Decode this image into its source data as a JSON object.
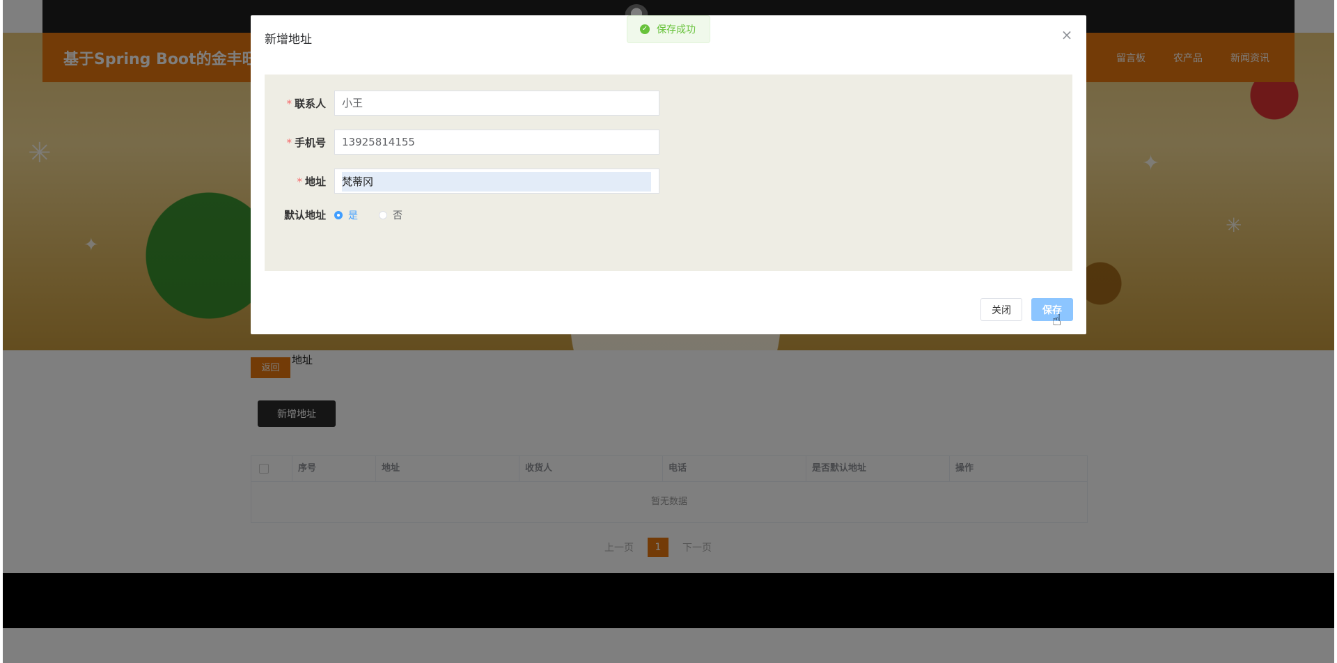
{
  "site": {
    "title": "基于Spring Boot的金丰旺",
    "nav": [
      "留言板",
      "农产品",
      "新闻资讯"
    ]
  },
  "page": {
    "back_label": "返回",
    "crumb": "地址",
    "add_label": "新增地址",
    "table": {
      "columns": [
        "序号",
        "地址",
        "收货人",
        "电话",
        "是否默认地址",
        "操作"
      ],
      "empty_text": "暂无数据"
    },
    "pager": {
      "prev": "上一页",
      "current": "1",
      "next": "下一页"
    }
  },
  "dialog": {
    "title": "新增地址",
    "fields": {
      "contact_label": "联系人",
      "contact_value": "小王",
      "phone_label": "手机号",
      "phone_value": "13925814155",
      "address_label": "地址",
      "address_value": "梵蒂冈",
      "default_label": "默认地址",
      "default_yes": "是",
      "default_no": "否",
      "default_selected": "是"
    },
    "close_label": "关闭",
    "save_label": "保存"
  },
  "toast": {
    "message": "保存成功"
  },
  "colors": {
    "brand": "#e7760f",
    "primary": "#409eff",
    "success": "#67c23a"
  }
}
